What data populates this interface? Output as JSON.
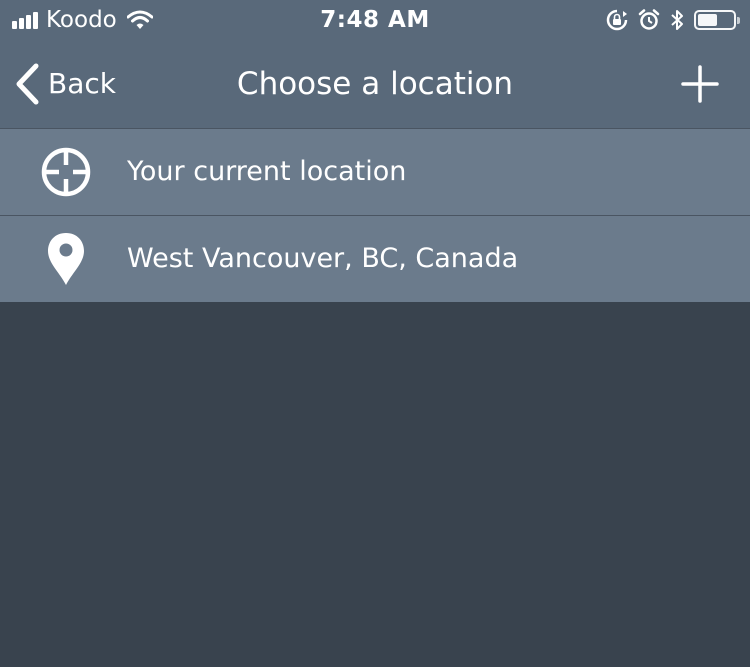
{
  "status_bar": {
    "carrier": "Koodo",
    "time": "7:48 AM",
    "icons": [
      "signal-bars-icon",
      "wifi-icon",
      "rotation-lock-icon",
      "alarm-icon",
      "bluetooth-icon",
      "battery-icon"
    ],
    "battery_level_percent": 55
  },
  "nav": {
    "back_label": "Back",
    "title": "Choose a location",
    "add_icon": "plus-icon"
  },
  "locations": [
    {
      "label": "Your current location",
      "icon": "crosshair-icon"
    },
    {
      "label": "West Vancouver, BC, Canada",
      "icon": "map-pin-icon"
    }
  ],
  "colors": {
    "header_bg": "#59697a",
    "row_bg": "#6b7b8c",
    "background": "#39434e",
    "text": "#ffffff"
  }
}
